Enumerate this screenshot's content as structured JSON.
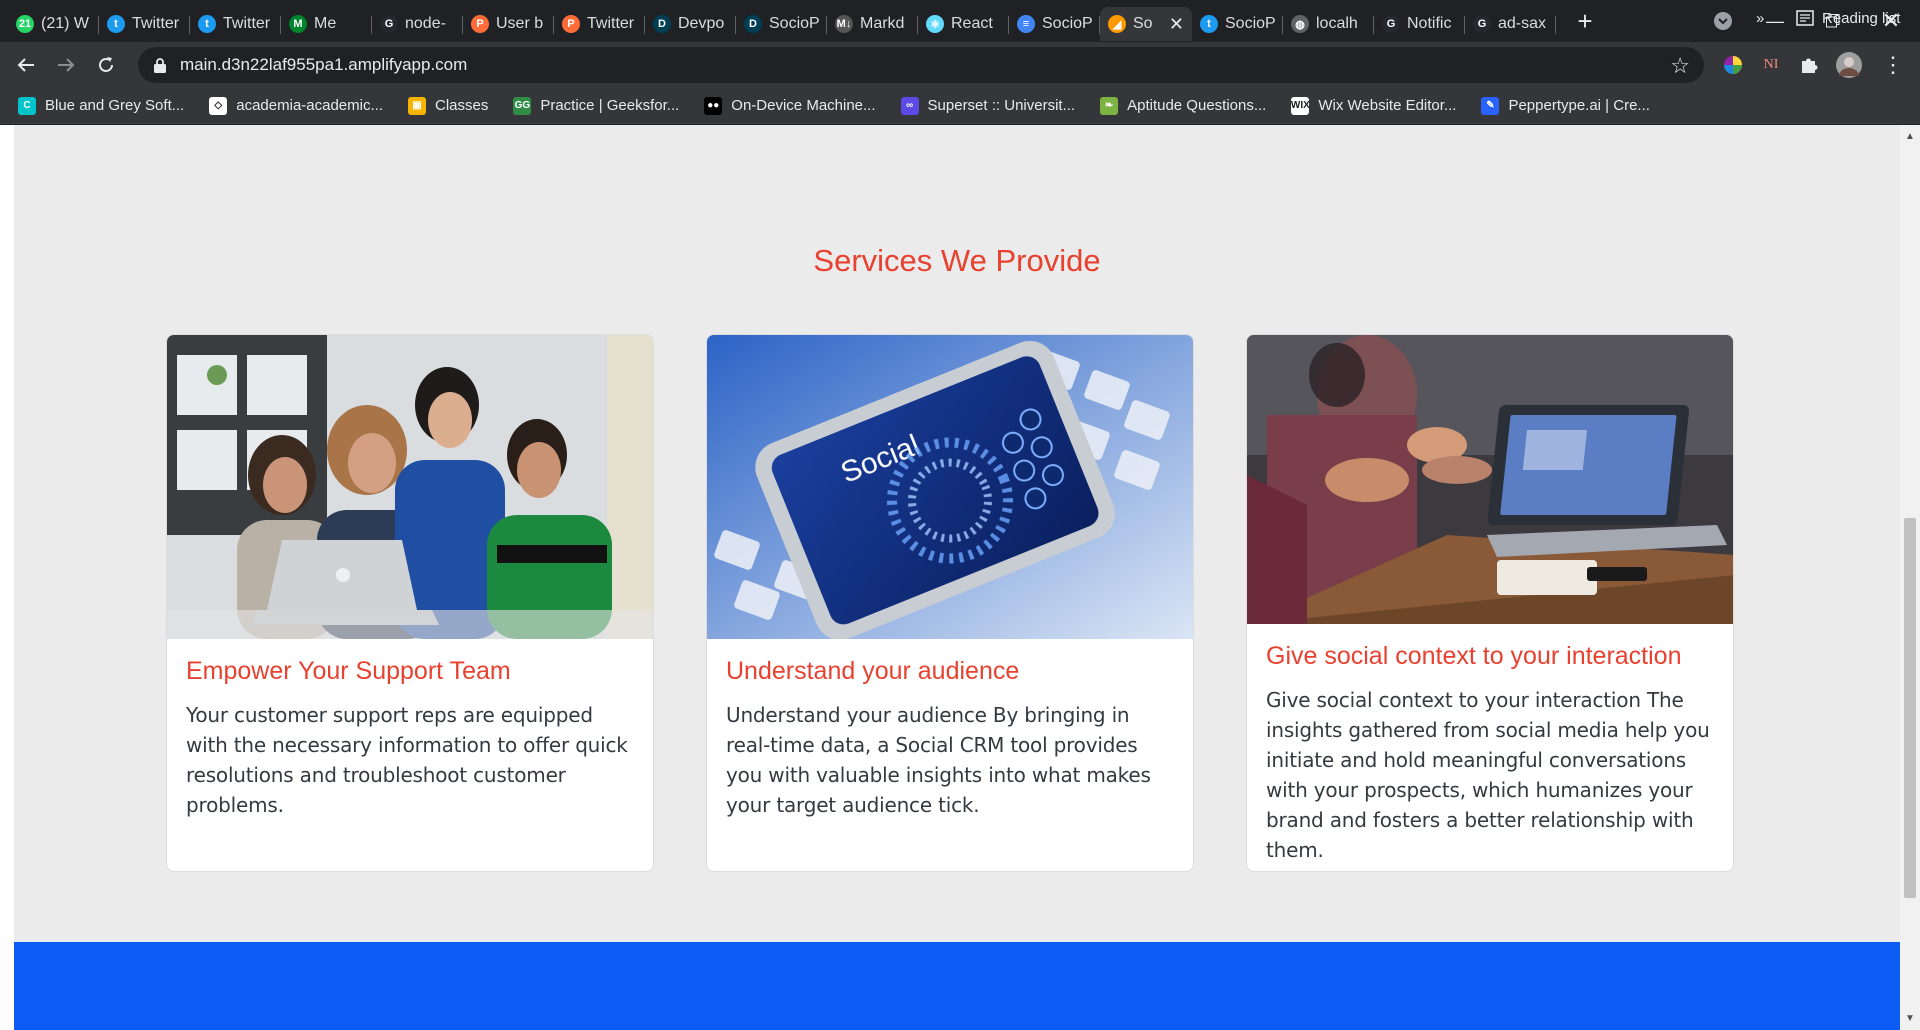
{
  "browser": {
    "tabs": [
      {
        "title": "(21) W",
        "icon": "whatsapp-icon",
        "color": "#25d366",
        "glyph": "21"
      },
      {
        "title": "Twitter",
        "icon": "twitter-icon",
        "color": "#1d9bf0",
        "glyph": "t"
      },
      {
        "title": "Twitter",
        "icon": "twitter-icon",
        "color": "#1d9bf0",
        "glyph": "t"
      },
      {
        "title": "Me",
        "icon": "meet-icon",
        "color": "#00832d",
        "glyph": "M"
      },
      {
        "title": "node-",
        "icon": "github-icon",
        "color": "#24292f",
        "glyph": "G"
      },
      {
        "title": "User b",
        "icon": "postman-icon",
        "color": "#ff6c37",
        "glyph": "P"
      },
      {
        "title": "Twitter",
        "icon": "postman-icon",
        "color": "#ff6c37",
        "glyph": "P"
      },
      {
        "title": "Devpo",
        "icon": "devpost-icon",
        "color": "#003e54",
        "glyph": "D"
      },
      {
        "title": "SocioP",
        "icon": "devpost-icon",
        "color": "#003e54",
        "glyph": "D"
      },
      {
        "title": "Markd",
        "icon": "markdown-icon",
        "color": "#555555",
        "glyph": "M↓"
      },
      {
        "title": "React",
        "icon": "react-icon",
        "color": "#61dafb",
        "glyph": "⚛"
      },
      {
        "title": "SocioP",
        "icon": "docs-icon",
        "color": "#4285f4",
        "glyph": "≡"
      },
      {
        "title": "So",
        "icon": "amplify-icon",
        "color": "#ff9900",
        "glyph": "◢",
        "active": true
      },
      {
        "title": "SocioP",
        "icon": "twitter-icon",
        "color": "#1d9bf0",
        "glyph": "t"
      },
      {
        "title": "localh",
        "icon": "globe-icon",
        "color": "#5f6368",
        "glyph": "◍"
      },
      {
        "title": "Notific",
        "icon": "github-icon",
        "color": "#24292f",
        "glyph": "G"
      },
      {
        "title": "ad-sax",
        "icon": "github-icon",
        "color": "#24292f",
        "glyph": "G"
      }
    ],
    "url": "main.d3n22laf955pa1.amplifyapp.com",
    "bookmarks": [
      {
        "label": "Blue and Grey Soft...",
        "icon": "canva-icon",
        "color": "#00c4cc",
        "glyph": "C"
      },
      {
        "label": "academia-academic...",
        "icon": "diamond-icon",
        "color": "#ffffff",
        "glyph": "◇"
      },
      {
        "label": "Classes",
        "icon": "classroom-icon",
        "color": "#f4b400",
        "glyph": "▣"
      },
      {
        "label": "Practice | Geeksfor...",
        "icon": "gfg-icon",
        "color": "#2f8d46",
        "glyph": "GG"
      },
      {
        "label": "On-Device Machine...",
        "icon": "coursera-icon",
        "color": "#000000",
        "glyph": "●●"
      },
      {
        "label": "Superset :: Universit...",
        "icon": "superset-icon",
        "color": "#5b4ae6",
        "glyph": "∞"
      },
      {
        "label": "Aptitude Questions...",
        "icon": "leaf-icon",
        "color": "#7cb342",
        "glyph": "❧"
      },
      {
        "label": "Wix Website Editor...",
        "icon": "wix-icon",
        "color": "#ffffff",
        "glyph": "WIX"
      },
      {
        "label": "Peppertype.ai | Cre...",
        "icon": "peppertype-icon",
        "color": "#2962ff",
        "glyph": "✎"
      }
    ],
    "overflow_label": "»",
    "reading_list": "Reading list"
  },
  "page": {
    "section_title": "Services We Provide",
    "cards": [
      {
        "title": "Empower Your Support Team",
        "text": "Your customer support reps are equipped with the necessary information to offer quick resolutions and troubleshoot customer problems.",
        "image": "team-laptop-photo"
      },
      {
        "title": "Understand your audience",
        "text": "Understand your audience By bringing in real-time data, a Social CRM tool provides you with valuable insights into what makes your target audience tick.",
        "image": "social-phone-photo",
        "image_caption": "Social"
      },
      {
        "title": "Give social context to your interaction",
        "text": "Give social context to your interaction The insights gathered from social media help you initiate and hold meaningful conversations with your prospects, which humanizes your brand and fosters a better relationship with them.",
        "image": "meeting-photo"
      }
    ],
    "colors": {
      "accent": "#e8412f",
      "band": "#0a5cf5",
      "background": "#ebebeb"
    }
  }
}
